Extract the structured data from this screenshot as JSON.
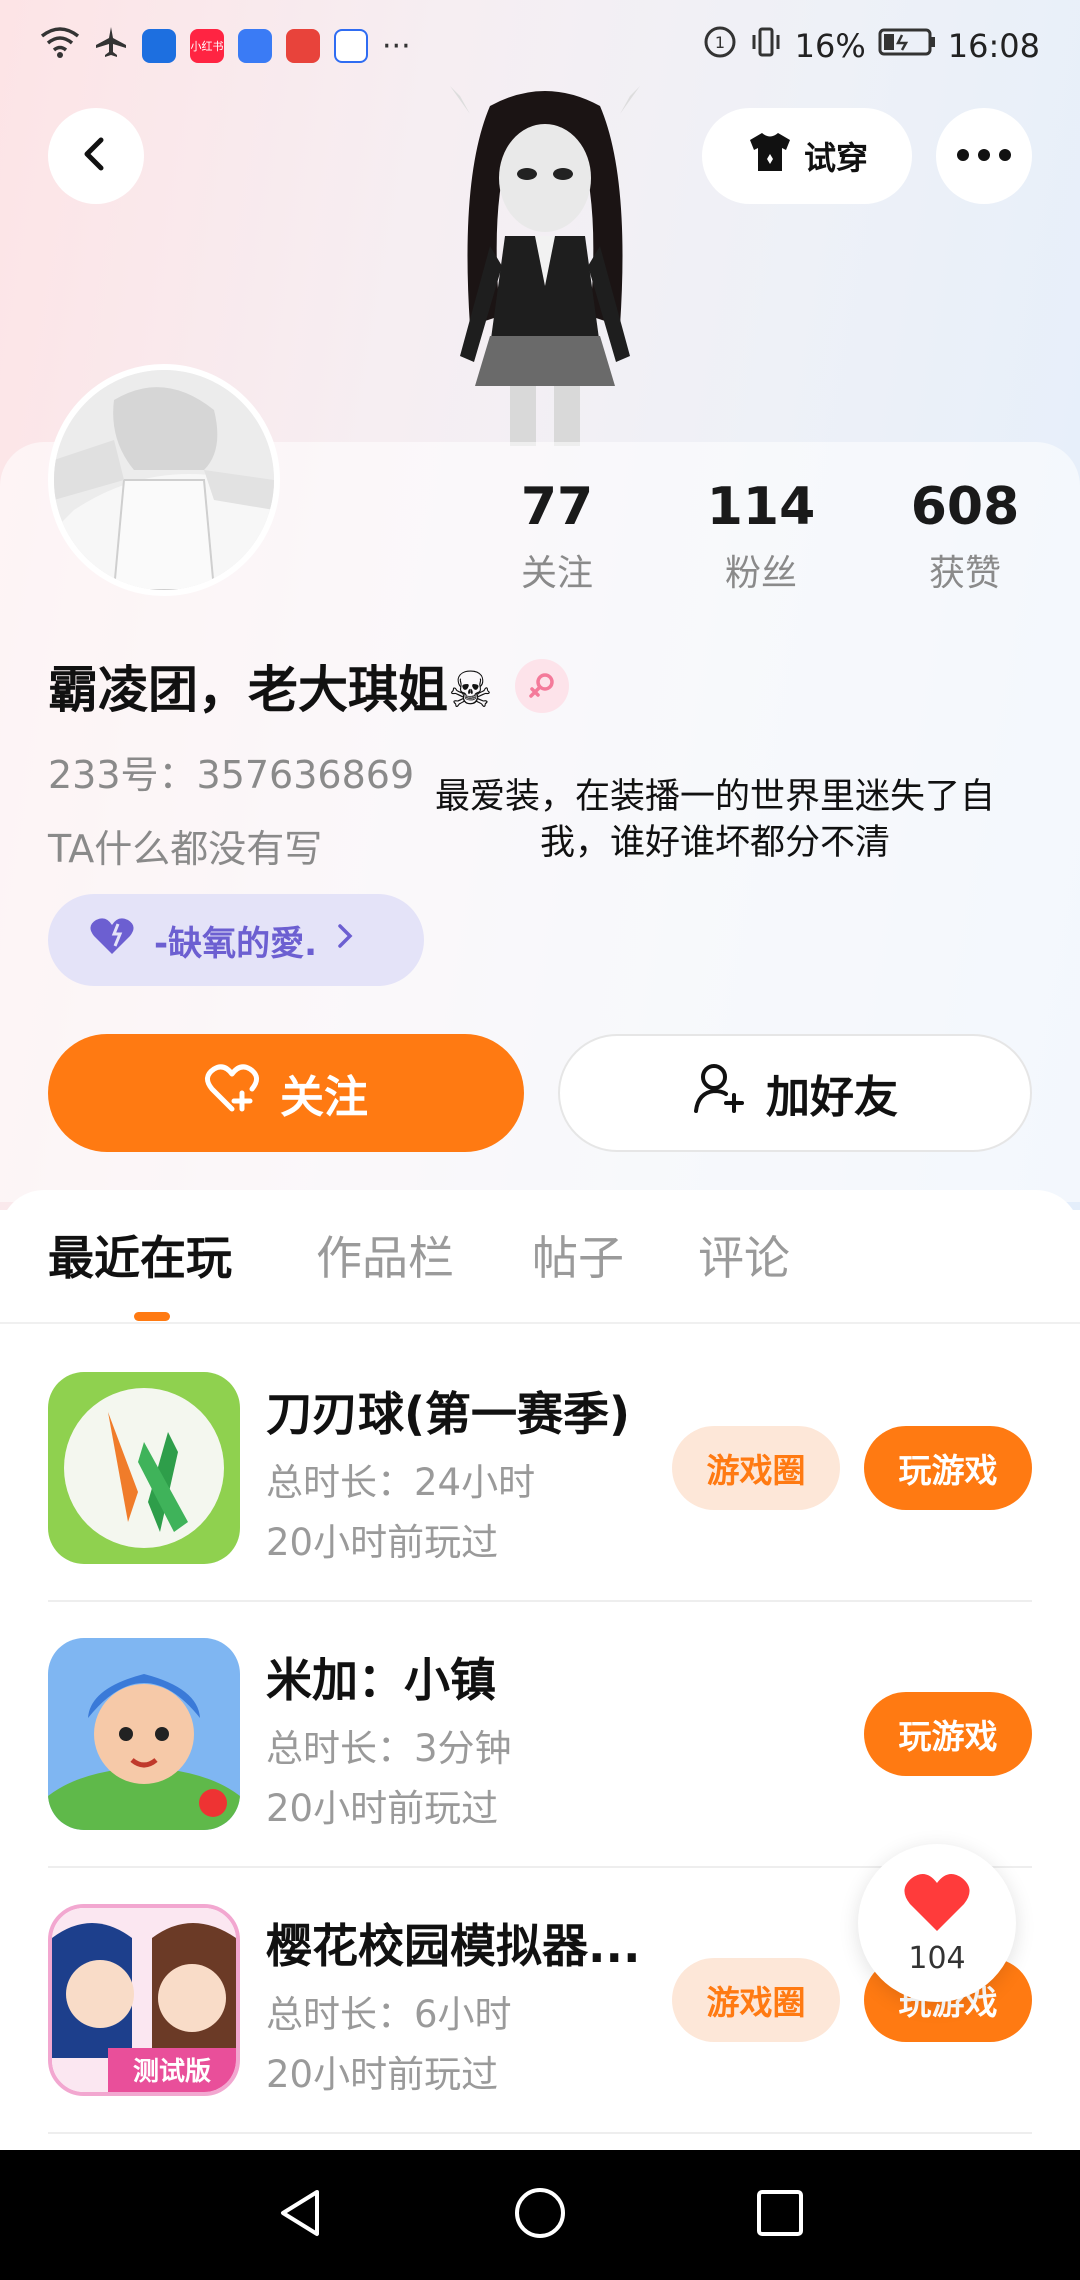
{
  "status_bar": {
    "app_icons": [
      "wifi-icon",
      "airplane-icon",
      "shield-app-icon",
      "xiaohongshu-app-icon",
      "music-app-icon",
      "huawei-store-app-icon",
      "baidu-app-icon"
    ],
    "xiaohongshu_label": "小红书",
    "more": "···",
    "battery": "16%",
    "time": "16:08"
  },
  "header": {
    "tryon_label": "试穿"
  },
  "profile": {
    "stats": [
      {
        "value": "77",
        "label": "关注"
      },
      {
        "value": "114",
        "label": "粉丝"
      },
      {
        "value": "608",
        "label": "获赞"
      }
    ],
    "username": "霸凌团，老大琪姐☠",
    "uid": "233号：357636869",
    "bio": "TA什么都没有写",
    "quote": "最爱装，在装播一的世界里迷失了自我，谁好谁坏都分不清",
    "group_tag": "-缺氧的愛."
  },
  "actions": {
    "follow_label": "关注",
    "add_friend_label": "加好友"
  },
  "tabs": [
    {
      "label": "最近在玩",
      "active": true
    },
    {
      "label": "作品栏",
      "active": false
    },
    {
      "label": "帖子",
      "active": false
    },
    {
      "label": "评论",
      "active": false
    }
  ],
  "games": [
    {
      "title": "刀刃球(第一赛季)",
      "duration": "总时长：24小时",
      "last_played": "20小时前玩过",
      "circle_label": "游戏圈",
      "play_label": "玩游戏",
      "has_circle": true
    },
    {
      "title": "米加：小镇",
      "duration": "总时长：3分钟",
      "last_played": "20小时前玩过",
      "play_label": "玩游戏",
      "has_circle": false
    },
    {
      "title": "樱花校园模拟器...",
      "duration": "总时长：6小时",
      "last_played": "20小时前玩过",
      "circle_label": "游戏圈",
      "play_label": "玩游戏",
      "has_circle": true,
      "icon_badge": "测试版"
    }
  ],
  "like_float": {
    "count": "104"
  },
  "colors": {
    "accent": "#ff7a12",
    "group_tag_bg": "#e4e3f8",
    "group_tag_text": "#6c5fd1"
  }
}
